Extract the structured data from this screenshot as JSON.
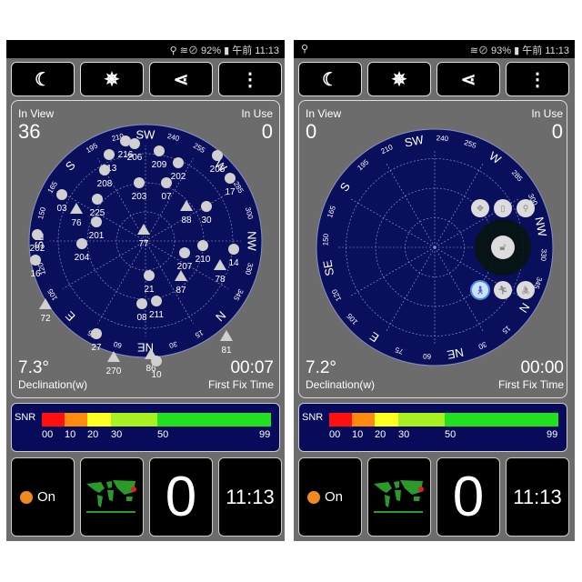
{
  "compass_ring": [
    "N",
    "15",
    "30",
    "NE",
    "60",
    "75",
    "E",
    "105",
    "120",
    "SE",
    "150",
    "165",
    "S",
    "195",
    "210",
    "SW",
    "240",
    "255",
    "W",
    "285",
    "300",
    "NW",
    "330",
    "345"
  ],
  "toolbar": {
    "icons": [
      "moon-icon",
      "compass-star-icon",
      "share-icon",
      "more-vert-icon"
    ],
    "glyphs": [
      "☾",
      "✵",
      "⋖",
      "⋮"
    ]
  },
  "colors": {
    "sky": "#0a0f5c",
    "panel": "#6c6c6c",
    "snr_red": "#ff1010",
    "snr_orange": "#ff8a10",
    "snr_yellow": "#ffff20",
    "snr_yellowgreen": "#a8f020",
    "snr_green": "#20e020",
    "gps_dot": "#f08a20"
  },
  "phones": [
    {
      "status": {
        "left_icon": "location-icon",
        "right": "⚲ ≋⊘ 92% ▮ 午前 11:13"
      },
      "in_view_label": "In View",
      "in_view": "36",
      "in_use_label": "In Use",
      "in_use": "0",
      "declination": "7.3°",
      "declination_label": "Declination(w)",
      "fix_time": "00:07",
      "fix_label": "First Fix Time",
      "snr_label": "SNR",
      "snr_ticks": [
        "00",
        "10",
        "20",
        "30",
        "50",
        "99"
      ],
      "gps_status": "On",
      "big_count": "0",
      "clock": "11:13",
      "satellites": [
        {
          "id": "216",
          "shape": "dot"
        },
        {
          "id": "206",
          "shape": "dot"
        },
        {
          "id": "213",
          "shape": "dot"
        },
        {
          "id": "208",
          "shape": "dot"
        },
        {
          "id": "209",
          "shape": "dot"
        },
        {
          "id": "202",
          "shape": "dot"
        },
        {
          "id": "205",
          "shape": "dot"
        },
        {
          "id": "17",
          "shape": "dot"
        },
        {
          "id": "203",
          "shape": "dot"
        },
        {
          "id": "07",
          "shape": "dot"
        },
        {
          "id": "03",
          "shape": "dot"
        },
        {
          "id": "225",
          "shape": "dot"
        },
        {
          "id": "76",
          "shape": "triangle"
        },
        {
          "id": "88",
          "shape": "triangle"
        },
        {
          "id": "30",
          "shape": "dot"
        },
        {
          "id": "201",
          "shape": "dot"
        },
        {
          "id": "77",
          "shape": "triangle"
        },
        {
          "id": "202",
          "shape": "dot"
        },
        {
          "id": "204",
          "shape": "dot"
        },
        {
          "id": "210",
          "shape": "dot"
        },
        {
          "id": "14",
          "shape": "dot"
        },
        {
          "id": "207",
          "shape": "dot"
        },
        {
          "id": "78",
          "shape": "triangle"
        },
        {
          "id": "16",
          "shape": "dot"
        },
        {
          "id": "21",
          "shape": "dot"
        },
        {
          "id": "87",
          "shape": "triangle"
        },
        {
          "id": "72",
          "shape": "triangle"
        },
        {
          "id": "08",
          "shape": "dot"
        },
        {
          "id": "211",
          "shape": "dot"
        },
        {
          "id": "27",
          "shape": "dot"
        },
        {
          "id": "81",
          "shape": "triangle"
        },
        {
          "id": "270",
          "shape": "triangle"
        },
        {
          "id": "86",
          "shape": "triangle"
        },
        {
          "id": "10",
          "shape": "dot"
        }
      ]
    },
    {
      "status": {
        "left_icon": "location-icon",
        "right": "≋⊘ 93% ▮ 午前 11:13"
      },
      "in_view_label": "In View",
      "in_view": "0",
      "in_use_label": "In Use",
      "in_use": "0",
      "declination": "7.2°",
      "declination_label": "Declination(w)",
      "fix_time": "00:00",
      "fix_label": "First Fix Time",
      "snr_label": "SNR",
      "snr_ticks": [
        "00",
        "10",
        "20",
        "30",
        "50",
        "99"
      ],
      "gps_status": "On",
      "big_count": "0",
      "clock": "11:13",
      "satellites": [],
      "overlay_icons": [
        "move-icon",
        "map-icon",
        "pin-icon",
        "unlock-icon",
        "walk-icon",
        "run-icon",
        "bike-icon"
      ]
    }
  ]
}
